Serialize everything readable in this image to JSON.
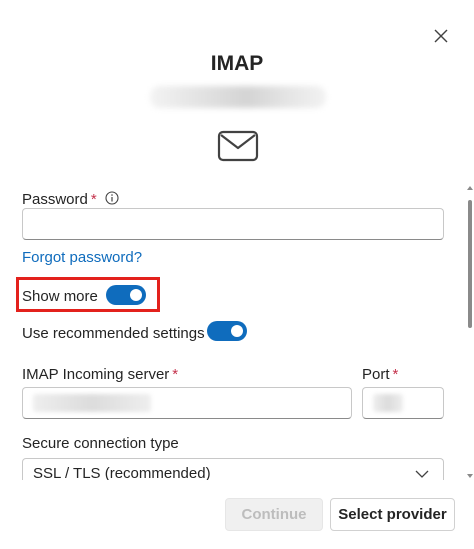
{
  "dialog": {
    "title": "IMAP",
    "close_icon": "close-icon",
    "mail_icon": "mail-icon"
  },
  "form": {
    "password_label": "Password",
    "required_mark": "*",
    "password_value": "",
    "forgot_password": "Forgot password?",
    "show_more_label": "Show more",
    "show_more_on": true,
    "recommended_label": "Use recommended settings",
    "recommended_on": true,
    "incoming_server_label": "IMAP Incoming server",
    "port_label": "Port",
    "secure_type_label": "Secure connection type",
    "secure_type_value": "SSL / TLS (recommended)"
  },
  "footer": {
    "continue_label": "Continue",
    "continue_disabled": true,
    "select_provider_label": "Select provider"
  },
  "colors": {
    "accent": "#0f6cbd",
    "required": "#c4314b",
    "highlight": "#e3211c"
  }
}
